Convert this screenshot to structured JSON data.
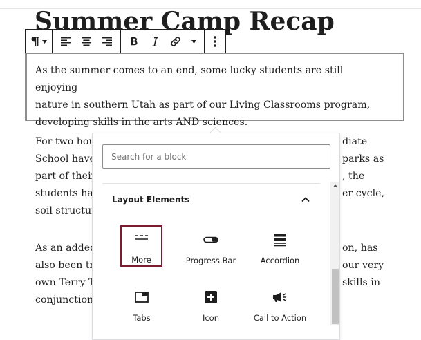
{
  "post": {
    "title": "Summer Camp Recap",
    "selected_paragraph": [
      "As the summer comes to an end, some lucky students are still enjoying",
      "nature in southern Utah as part of our Living Classrooms program,",
      "developing skills in the arts AND sciences."
    ],
    "paragraph2_left": [
      "For two hou",
      "School have",
      "part of their",
      "students hav",
      "soil structur"
    ],
    "paragraph2_right": [
      "diate",
      "parks as",
      ", the",
      "er cycle,"
    ],
    "paragraph3_left": [
      "As an added",
      "also been tra",
      "own Terry T",
      "conjunction"
    ],
    "paragraph3_right": [
      "on, has",
      "our very",
      "skills in"
    ]
  },
  "toolbar": {
    "icons": [
      "paragraph-icon",
      "align-left-icon",
      "align-center-icon",
      "align-right-icon",
      "bold-icon",
      "italic-icon",
      "link-icon",
      "more-options-icon"
    ]
  },
  "inserter": {
    "search_placeholder": "Search for a block",
    "section_title": "Layout Elements",
    "blocks": [
      {
        "label": "More",
        "icon": "more-icon",
        "selected": true
      },
      {
        "label": "Progress Bar",
        "icon": "progress-bar-icon",
        "selected": false
      },
      {
        "label": "Accordion",
        "icon": "accordion-icon",
        "selected": false
      },
      {
        "label": "Tabs",
        "icon": "tabs-icon",
        "selected": false
      },
      {
        "label": "Icon",
        "icon": "plus-square-icon",
        "selected": false
      },
      {
        "label": "Call to Action",
        "icon": "megaphone-icon",
        "selected": false
      }
    ]
  },
  "colors": {
    "selection_border": "#7b1c2e",
    "text": "#1e1e1e",
    "border": "#8d8d8d"
  }
}
